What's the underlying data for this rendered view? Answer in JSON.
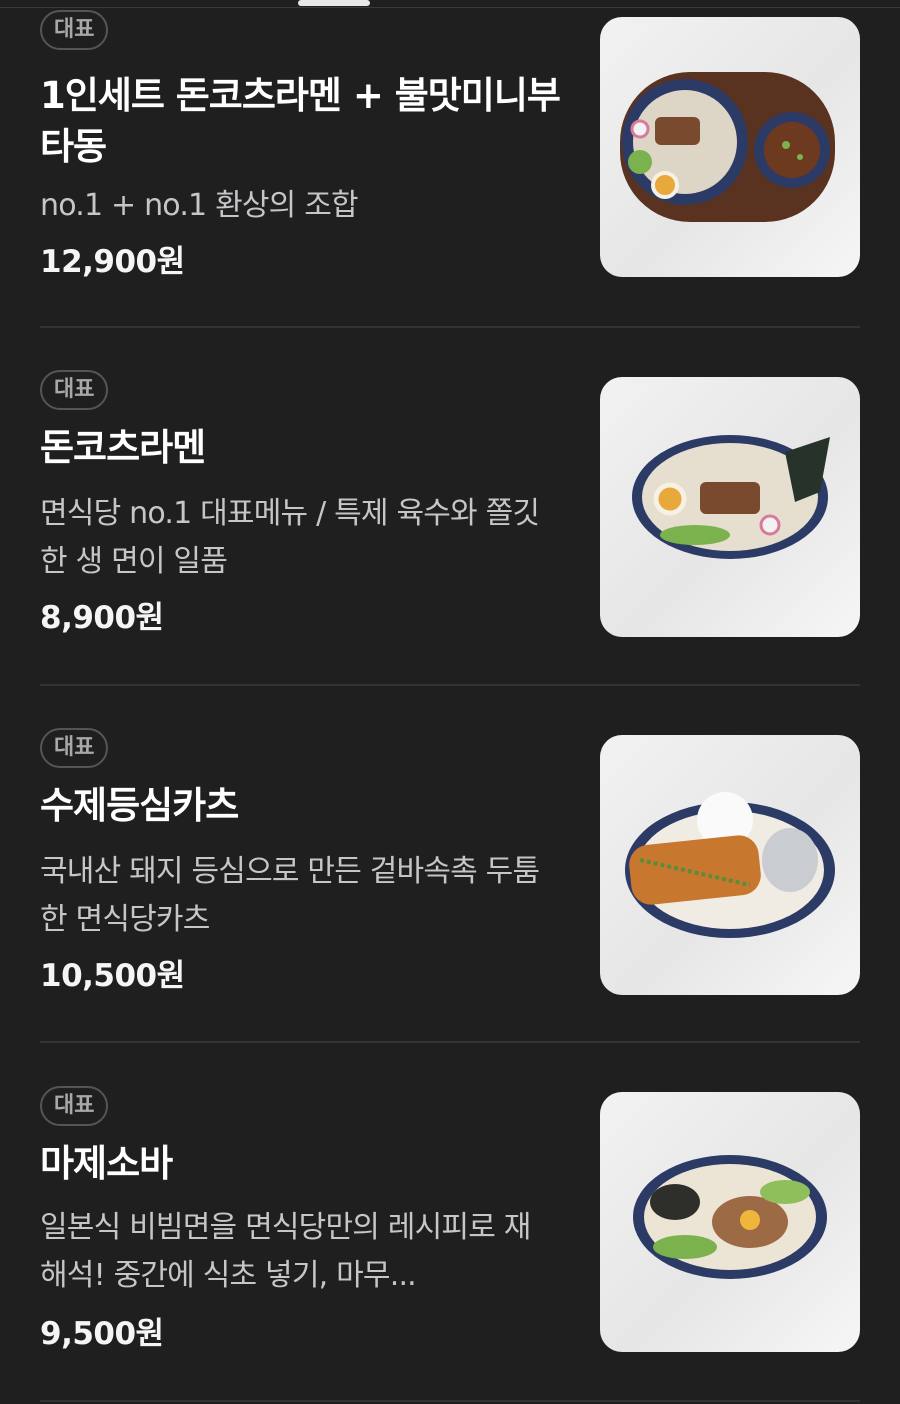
{
  "menu": {
    "items": [
      {
        "badge": "대표",
        "name": "1인세트 돈코츠라멘 + 불맛미니부타동",
        "desc": "no.1 + no.1 환상의 조합",
        "price": "12,900원",
        "image_icon": "ramen-set-photo"
      },
      {
        "badge": "대표",
        "name": "돈코츠라멘",
        "desc": "면식당 no.1 대표메뉴 / 특제 육수와 쫄깃한 생 면이 일품",
        "price": "8,900원",
        "image_icon": "tonkotsu-ramen-photo"
      },
      {
        "badge": "대표",
        "name": "수제등심카츠",
        "desc": "국내산 돼지 등심으로 만든 겉바속촉 두툼한 면식당카츠",
        "price": "10,500원",
        "image_icon": "pork-cutlet-photo"
      },
      {
        "badge": "대표",
        "name": "마제소바",
        "desc": "일본식 비빔면을 면식당만의 레시피로 재 해석! 중간에 식초 넣기, 마무...",
        "price": "9,500원",
        "image_icon": "mazesoba-photo"
      }
    ]
  },
  "colors": {
    "background": "#1f1f20",
    "text_primary": "#ffffff",
    "text_secondary": "#c6c6c8",
    "badge_border": "#555557",
    "divider": "#333335"
  }
}
